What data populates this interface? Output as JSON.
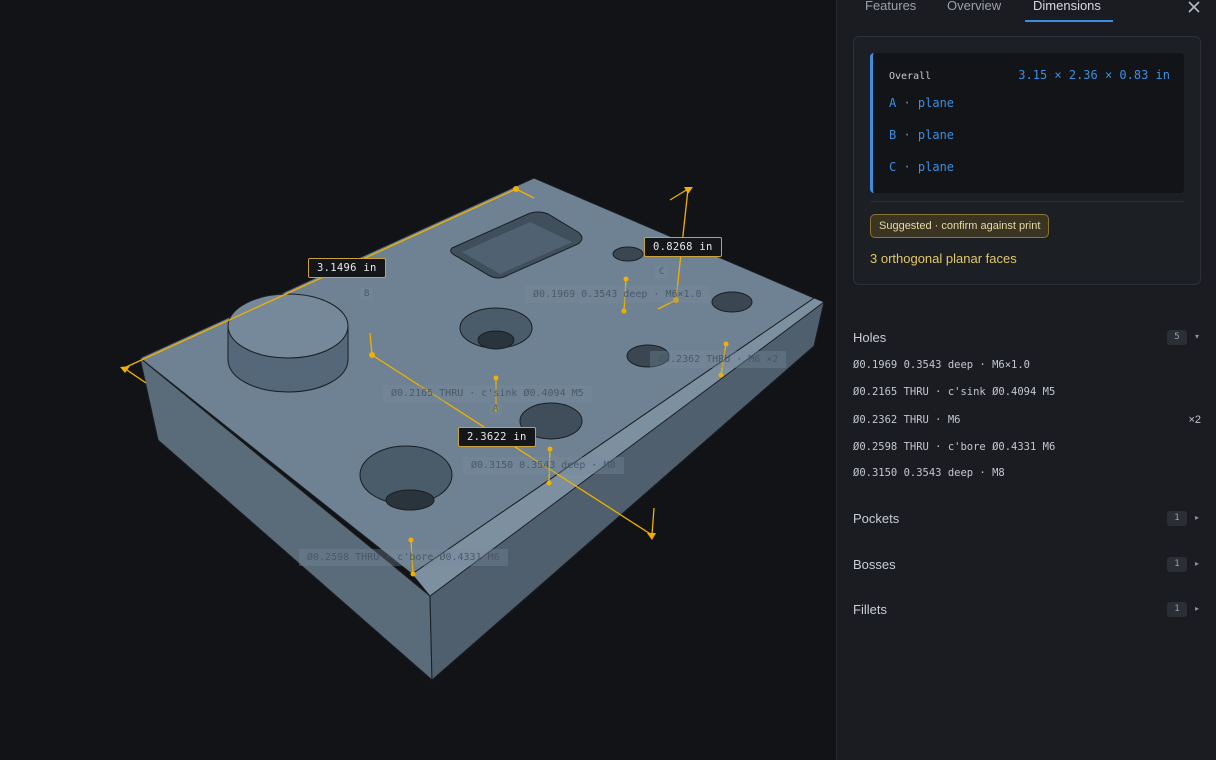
{
  "viewport": {
    "dimensions": {
      "length": "3.1496 in",
      "height": "0.8268 in",
      "width": "2.3622 in"
    },
    "feature_annotations": [
      "Ø0.1969 0.3543 deep · M6×1.0",
      "Ø0.2362 THRU · M6 ×2",
      "Ø0.2165 THRU · c'sink Ø0.4094 M5",
      "Ø0.3150 0.3543 deep · M8",
      "Ø0.2598 THRU · c'bore Ø0.4331 M6"
    ],
    "datum_markers": [
      "B",
      "C",
      "A"
    ]
  },
  "panel": {
    "tabs": [
      "Features",
      "Overview",
      "Dimensions"
    ],
    "active_tab": "Dimensions",
    "datums": {
      "overall_label": "Overall",
      "overall_value": "3.15 × 2.36 × 0.83 in",
      "rows": [
        "A · plane",
        "B · plane",
        "C · plane"
      ]
    },
    "suggestion_badge": "Suggested · confirm against print",
    "faces_text": "3 orthogonal planar faces",
    "sections": {
      "holes": {
        "title": "Holes",
        "count": "5",
        "items": [
          {
            "text": "Ø0.1969 0.3543 deep · M6×1.0",
            "mult": ""
          },
          {
            "text": "Ø0.2165 THRU · c'sink Ø0.4094 M5",
            "mult": ""
          },
          {
            "text": "Ø0.2362 THRU · M6",
            "mult": "×2"
          },
          {
            "text": "Ø0.2598 THRU · c'bore Ø0.4331 M6",
            "mult": ""
          },
          {
            "text": "Ø0.3150 0.3543 deep · M8",
            "mult": ""
          }
        ]
      },
      "pockets": {
        "title": "Pockets",
        "count": "1"
      },
      "bosses": {
        "title": "Bosses",
        "count": "1"
      },
      "fillets": {
        "title": "Fillets",
        "count": "1"
      }
    }
  },
  "colors": {
    "accent": "#3d8ee0",
    "dimension": "#f0b000",
    "part_top": "#6e8293",
    "suggest": "#e2c866"
  }
}
